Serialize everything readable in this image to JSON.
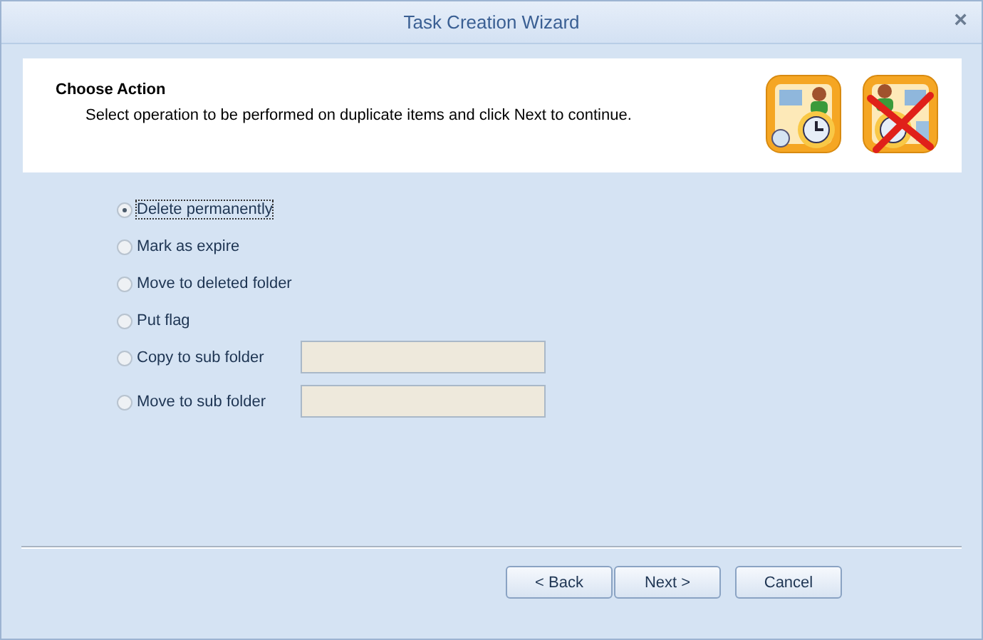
{
  "window": {
    "title": "Task Creation Wizard",
    "close": "×"
  },
  "header": {
    "title": "Choose Action",
    "subtitle": "Select operation to be performed on duplicate items and click Next to continue."
  },
  "options": [
    {
      "label": "Delete permanently",
      "selected": true,
      "kind": "radio"
    },
    {
      "label": "Mark as expire",
      "selected": false,
      "kind": "radio"
    },
    {
      "label": "Move to deleted folder",
      "selected": false,
      "kind": "radio"
    },
    {
      "label": "Put flag",
      "selected": false,
      "kind": "radio"
    },
    {
      "label": "Copy to sub folder",
      "selected": false,
      "kind": "folder"
    },
    {
      "label": "Move to sub folder",
      "selected": false,
      "kind": "folder"
    }
  ],
  "buttons": [
    "< Back",
    "Next >",
    "Cancel"
  ]
}
